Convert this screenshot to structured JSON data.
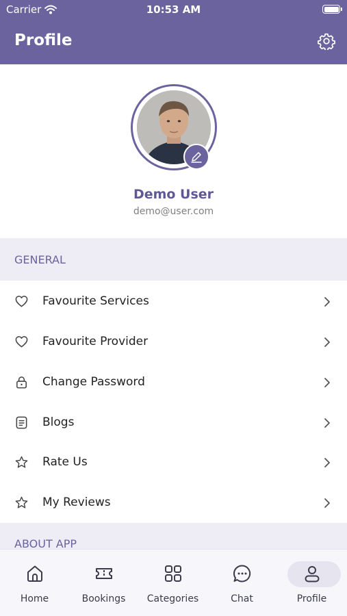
{
  "status_bar": {
    "carrier": "Carrier",
    "time": "10:53 AM"
  },
  "header": {
    "title": "Profile",
    "settings_icon": "gear-icon"
  },
  "profile": {
    "name": "Demo User",
    "email": "demo@user.com",
    "edit_icon": "pencil-icon"
  },
  "sections": {
    "general": "GENERAL",
    "about": "ABOUT APP"
  },
  "menu": [
    {
      "label": "Favourite Services",
      "icon": "heart-icon"
    },
    {
      "label": "Favourite Provider",
      "icon": "heart-icon"
    },
    {
      "label": "Change Password",
      "icon": "lock-icon"
    },
    {
      "label": "Blogs",
      "icon": "document-icon"
    },
    {
      "label": "Rate Us",
      "icon": "star-icon"
    },
    {
      "label": "My Reviews",
      "icon": "star-icon"
    }
  ],
  "nav": [
    {
      "label": "Home",
      "icon": "home-icon"
    },
    {
      "label": "Bookings",
      "icon": "ticket-icon"
    },
    {
      "label": "Categories",
      "icon": "grid-icon"
    },
    {
      "label": "Chat",
      "icon": "chat-icon"
    },
    {
      "label": "Profile",
      "icon": "user-icon",
      "active": true
    }
  ],
  "colors": {
    "primary": "#6a639e",
    "section_bg": "#eeedf5",
    "nav_bg": "#f7f7fb"
  }
}
